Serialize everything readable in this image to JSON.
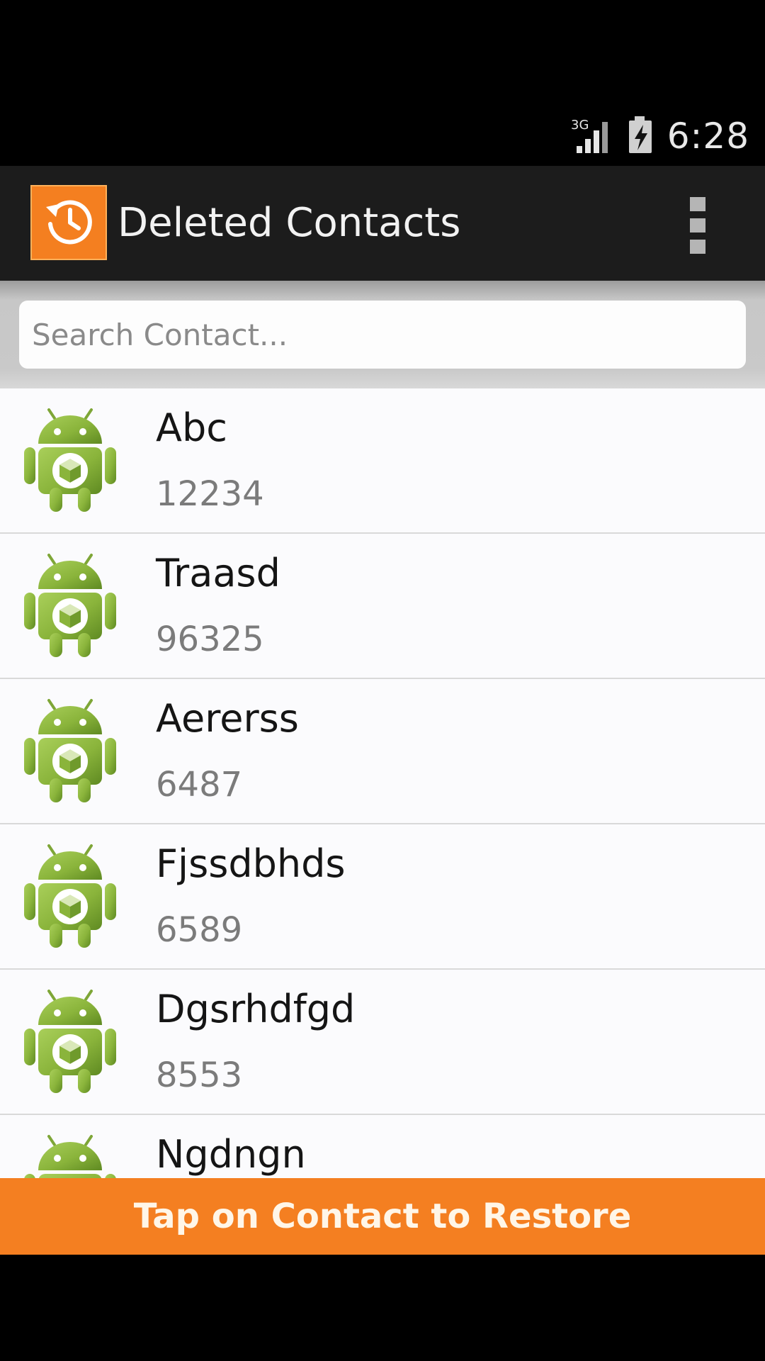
{
  "status_bar": {
    "network": "3G",
    "time": "6:28",
    "icons": [
      "signal-3g-icon",
      "battery-charging-icon"
    ]
  },
  "action_bar": {
    "title": "Deleted Contacts",
    "app_icon": "restore-clock-icon",
    "menu_icon": "overflow-menu-icon"
  },
  "search": {
    "placeholder": "Search Contact...",
    "value": ""
  },
  "contacts": [
    {
      "name": "Abc",
      "number": "12234",
      "icon": "android-icon"
    },
    {
      "name": "Traasd",
      "number": "96325",
      "icon": "android-icon"
    },
    {
      "name": "Aererss",
      "number": "6487",
      "icon": "android-icon"
    },
    {
      "name": "Fjssdbhds",
      "number": "6589",
      "icon": "android-icon"
    },
    {
      "name": "Dgsrhdfgd",
      "number": "8553",
      "icon": "android-icon"
    },
    {
      "name": "Ngdngn",
      "number": "",
      "icon": "android-icon"
    }
  ],
  "footer": {
    "label": "Tap on Contact to Restore"
  },
  "colors": {
    "accent": "#f47f21",
    "action_bar": "#1c1c1c",
    "android_green": "#8cb53f"
  }
}
